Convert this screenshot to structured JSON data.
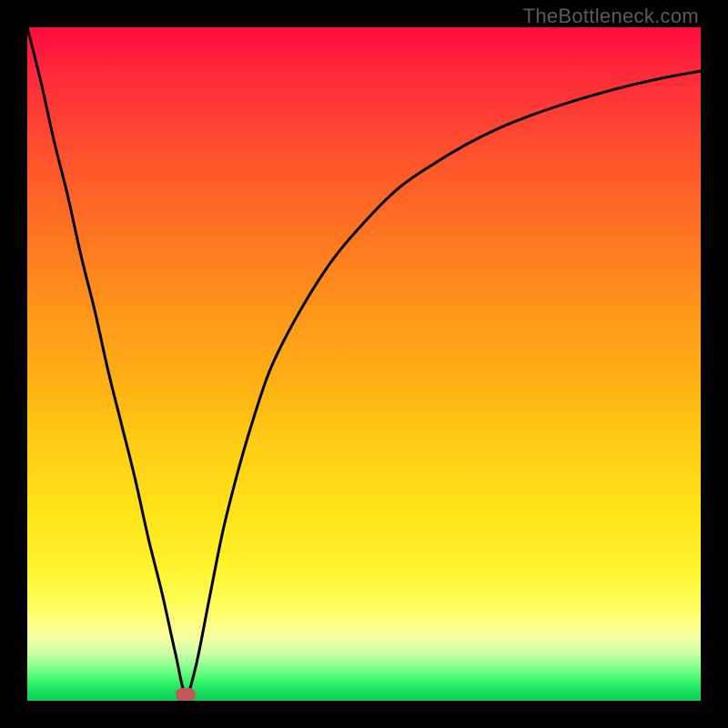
{
  "watermark": "TheBottleneck.com",
  "colors": {
    "curve_stroke": "#000000",
    "marker_fill": "#c05958",
    "frame_bg": "#000000"
  },
  "chart_data": {
    "type": "line",
    "title": "",
    "xlabel": "",
    "ylabel": "",
    "xlim": [
      0,
      100
    ],
    "ylim": [
      0,
      100
    ],
    "series": [
      {
        "name": "bottleneck-curve",
        "x": [
          0,
          2,
          4,
          6,
          8,
          10,
          12,
          14,
          16,
          18,
          20,
          22,
          23.5,
          25,
          27,
          29,
          31,
          33,
          36,
          40,
          45,
          50,
          55,
          60,
          65,
          70,
          75,
          80,
          85,
          90,
          95,
          100
        ],
        "y": [
          100,
          92,
          83,
          75,
          66,
          58,
          49,
          41,
          33,
          24,
          16,
          7,
          1,
          5,
          15,
          25,
          33,
          40,
          49,
          57,
          65,
          71,
          76,
          79.5,
          82.5,
          85,
          87,
          88.7,
          90.2,
          91.5,
          92.6,
          93.5
        ]
      }
    ],
    "marker": {
      "x": 23.5,
      "y": 1
    },
    "gradient_stops": [
      {
        "pct": 0,
        "color": "#ff0b3f"
      },
      {
        "pct": 50,
        "color": "#ffb414"
      },
      {
        "pct": 88,
        "color": "#fffe7a"
      },
      {
        "pct": 100,
        "color": "#0ecf55"
      }
    ]
  }
}
